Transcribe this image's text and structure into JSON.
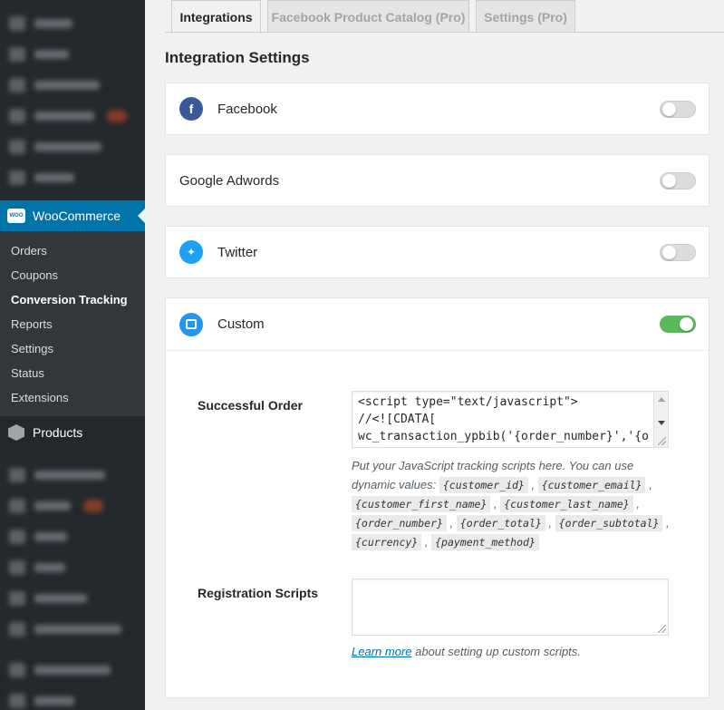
{
  "sidebar": {
    "woocommerce_label": "WooCommerce",
    "woo_icon_text": "WOO",
    "submenu": [
      {
        "label": "Orders"
      },
      {
        "label": "Coupons"
      },
      {
        "label": "Conversion Tracking",
        "current": true
      },
      {
        "label": "Reports"
      },
      {
        "label": "Settings"
      },
      {
        "label": "Status"
      },
      {
        "label": "Extensions"
      }
    ],
    "products_label": "Products"
  },
  "tabs": [
    {
      "label": "Integrations",
      "active": true
    },
    {
      "label": "Facebook Product Catalog (Pro)",
      "active": false
    },
    {
      "label": "Settings (Pro)",
      "active": false
    }
  ],
  "section_title": "Integration Settings",
  "integrations": {
    "facebook": {
      "label": "Facebook",
      "icon": "facebook-icon",
      "enabled": false
    },
    "google": {
      "label": "Google Adwords",
      "enabled": false
    },
    "twitter": {
      "label": "Twitter",
      "icon": "twitter-icon",
      "enabled": false
    },
    "custom": {
      "label": "Custom",
      "icon": "custom-code-icon",
      "enabled": true
    }
  },
  "custom_settings": {
    "successful_order_label": "Successful Order",
    "successful_order_lines": [
      "<script type=\"text/javascript\">",
      "//<![CDATA[",
      "wc_transaction_ypbib('{order_number}','{o"
    ],
    "help_intro": "Put your JavaScript tracking scripts here. You can use dynamic values:",
    "dynamic_values": [
      "{customer_id}",
      "{customer_email}",
      "{customer_first_name}",
      "{customer_last_name}",
      "{order_number}",
      "{order_total}",
      "{order_subtotal}",
      "{currency}",
      "{payment_method}"
    ],
    "registration_label": "Registration Scripts",
    "registration_value": "",
    "learn_more_link": "Learn more",
    "learn_more_suffix": " about setting up custom scripts."
  },
  "colors": {
    "sidebar_bg": "#23282d",
    "active_menu": "#0073aa",
    "toggle_on": "#5cb85c",
    "facebook": "#3b5998",
    "twitter": "#1da1f2"
  }
}
